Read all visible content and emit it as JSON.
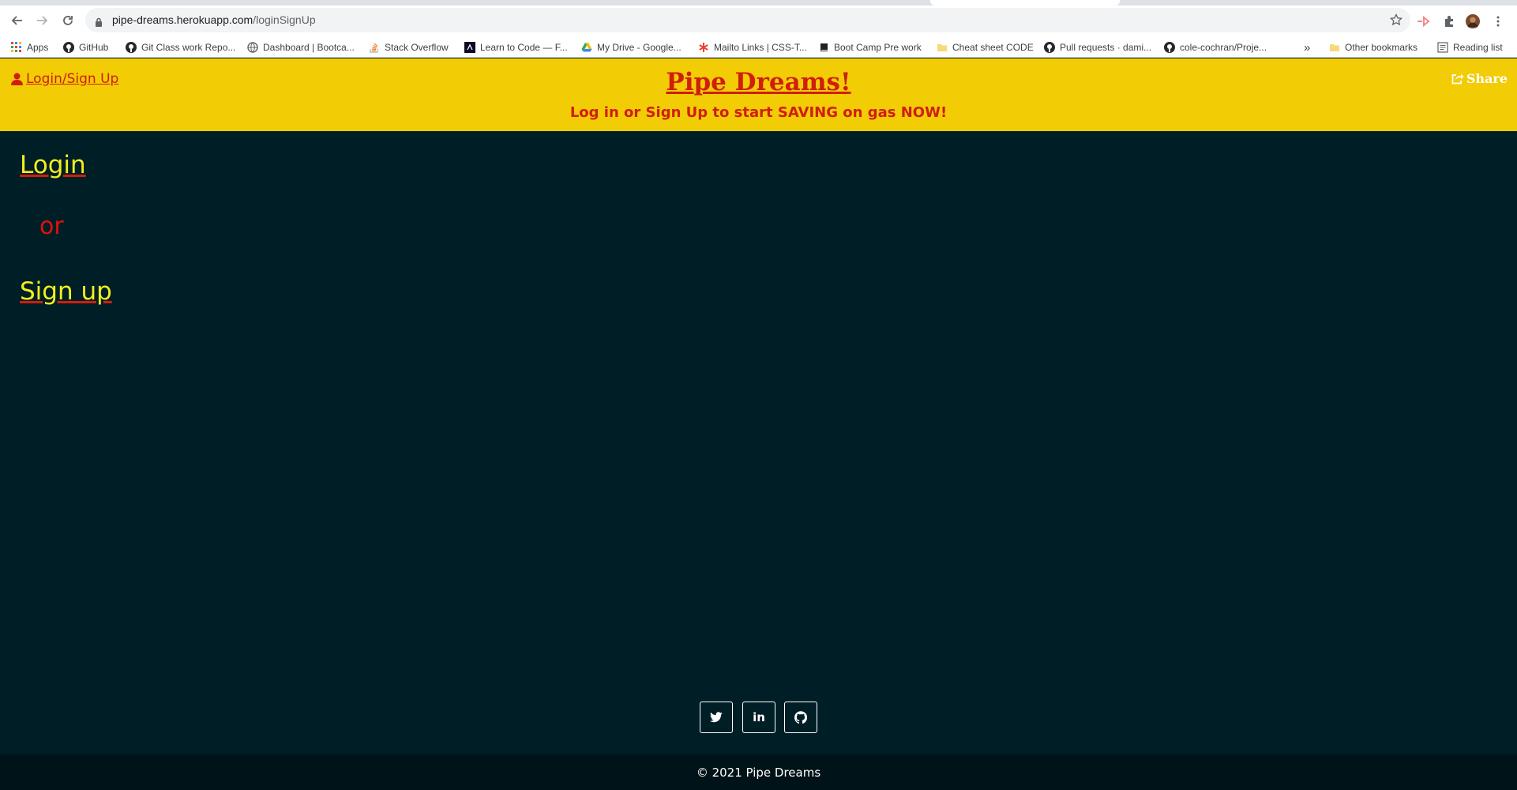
{
  "browser": {
    "url_host": "pipe-dreams.herokuapp.com",
    "url_path": "/loginSignUp",
    "bookmarks": [
      {
        "label": "Apps",
        "icon": "apps-grid-icon"
      },
      {
        "label": "GitHub",
        "icon": "github-icon"
      },
      {
        "label": "Git Class work Repo...",
        "icon": "github-icon"
      },
      {
        "label": "Dashboard | Bootca...",
        "icon": "globe-icon"
      },
      {
        "label": "Stack Overflow",
        "icon": "stackoverflow-icon"
      },
      {
        "label": "Learn to Code — F...",
        "icon": "freecodecamp-icon"
      },
      {
        "label": "My Drive - Google...",
        "icon": "google-drive-icon"
      },
      {
        "label": "Mailto Links | CSS-T...",
        "icon": "css-tricks-icon"
      },
      {
        "label": "Boot Camp Pre work",
        "icon": "book-icon"
      },
      {
        "label": "Cheat sheet CODE",
        "icon": "folder-icon"
      },
      {
        "label": "Pull requests · dami...",
        "icon": "github-icon"
      },
      {
        "label": "cole-cochran/Proje...",
        "icon": "github-icon"
      }
    ],
    "bookmarks_overflow": "»",
    "other_bookmarks": "Other bookmarks",
    "reading_list": "Reading list"
  },
  "header": {
    "login_link": " Login/Sign Up",
    "title": "Pipe Dreams!",
    "subtitle": "Log in or Sign Up to start SAVING on gas NOW!",
    "share": "Share"
  },
  "main": {
    "login": "Login",
    "or": "or",
    "signup": "Sign up"
  },
  "social": {
    "linkedin_label": "in"
  },
  "footer": {
    "copyright": "© 2021 Pipe Dreams"
  },
  "colors": {
    "header_bg": "#f2cc05",
    "page_bg": "#001e26",
    "accent_red": "#d01e0d",
    "link_yellow": "#f2ee20"
  }
}
